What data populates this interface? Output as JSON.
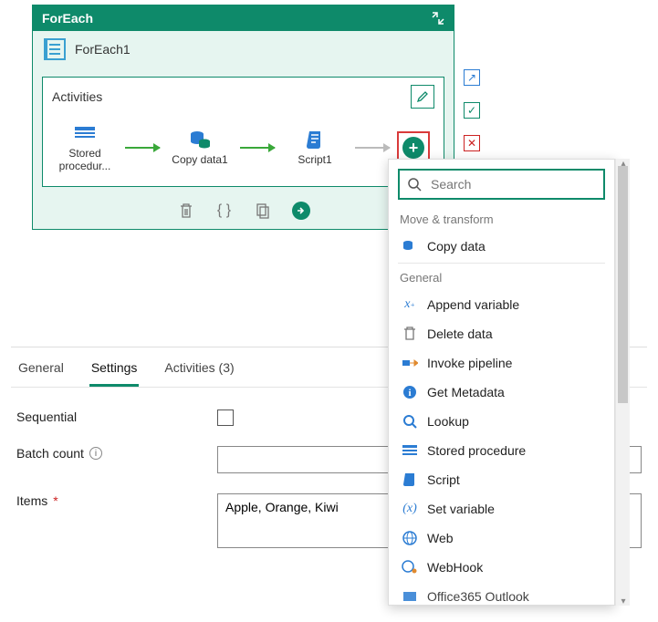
{
  "panel": {
    "header_title": "ForEach",
    "instance_name": "ForEach1",
    "activities_label": "Activities",
    "activities": [
      {
        "label": "Stored procedur..."
      },
      {
        "label": "Copy data1"
      },
      {
        "label": "Script1"
      }
    ]
  },
  "tabs": {
    "general": "General",
    "settings": "Settings",
    "activities": "Activities (3)"
  },
  "form": {
    "sequential_label": "Sequential",
    "batch_count_label": "Batch count",
    "batch_count_value": "",
    "items_label": "Items",
    "items_value": "Apple, Orange, Kiwi"
  },
  "popup": {
    "search_placeholder": "Search",
    "sections": {
      "move_transform": "Move & transform",
      "general": "General"
    },
    "items": {
      "copy_data": "Copy data",
      "append_variable": "Append variable",
      "delete_data": "Delete data",
      "invoke_pipeline": "Invoke pipeline",
      "get_metadata": "Get Metadata",
      "lookup": "Lookup",
      "stored_procedure": "Stored procedure",
      "script": "Script",
      "set_variable": "Set variable",
      "web": "Web",
      "webhook": "WebHook",
      "office365_outlook": "Office365 Outlook"
    }
  }
}
